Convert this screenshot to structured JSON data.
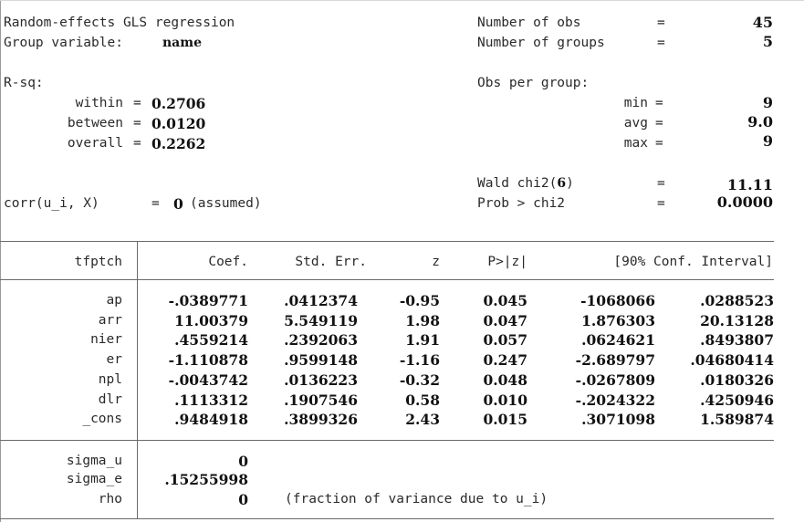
{
  "header": {
    "title": "Random-effects GLS regression",
    "group_var_label": "Group variable: ",
    "group_var_value": "name",
    "nobs_label": "Number of obs",
    "nobs_value": "45",
    "ngroups_label": "Number of groups",
    "ngroups_value": "5",
    "eq": "=",
    "rsq_label": "R-sq:",
    "within_label": "within",
    "within_value": "0.2706",
    "between_label": "between",
    "between_value": "0.0120",
    "overall_label": "overall",
    "overall_value": "0.2262",
    "obs_per_group_label": "Obs per group:",
    "min_label": "min",
    "min_value": "9",
    "avg_label": "avg",
    "avg_value": "9.0",
    "max_label": "max",
    "max_value": "9",
    "wald_label": "Wald chi2(",
    "wald_df": "6",
    "wald_close": ")",
    "wald_value": "11.11",
    "prob_label": "Prob > chi2",
    "prob_value": "0.0000",
    "corr_label": "corr(u_i, X)",
    "corr_value": "0",
    "corr_note": "(assumed)"
  },
  "table": {
    "dep_var": "tfptch",
    "columns": [
      "Coef.",
      "Std. Err.",
      "z",
      "P>|z|",
      "[90% Conf. Interval]"
    ],
    "rows": [
      {
        "name": "ap",
        "coef": "-.0389771",
        "se": ".0412374",
        "z": "-0.95",
        "p": "0.045",
        "lo": "-1068066",
        "hi": ".0288523"
      },
      {
        "name": "arr",
        "coef": "11.00379",
        "se": "5.549119",
        "z": "1.98",
        "p": "0.047",
        "lo": "1.876303",
        "hi": "20.13128"
      },
      {
        "name": "nier",
        "coef": ".4559214",
        "se": ".2392063",
        "z": "1.91",
        "p": "0.057",
        "lo": ".0624621",
        "hi": ".8493807"
      },
      {
        "name": "er",
        "coef": "-1.110878",
        "se": ".9599148",
        "z": "-1.16",
        "p": "0.247",
        "lo": "-2.689797",
        "hi": ".04680414"
      },
      {
        "name": "npl",
        "coef": "-.0043742",
        "se": ".0136223",
        "z": "-0.32",
        "p": "0.048",
        "lo": "-.0267809",
        "hi": ".0180326"
      },
      {
        "name": "dlr",
        "coef": ".1113312",
        "se": ".1907546",
        "z": "0.58",
        "p": "0.010",
        "lo": "-.2024322",
        "hi": ".4250946"
      },
      {
        "name": "_cons",
        "coef": ".9484918",
        "se": ".3899326",
        "z": "2.43",
        "p": "0.015",
        "lo": ".3071098",
        "hi": "1.589874"
      }
    ],
    "sigma_u_label": "sigma_u",
    "sigma_u_value": "0",
    "sigma_e_label": "sigma_e",
    "sigma_e_value": ".15255998",
    "rho_label": "rho",
    "rho_value": "0",
    "rho_note": "(fraction of variance due to u_i)"
  }
}
